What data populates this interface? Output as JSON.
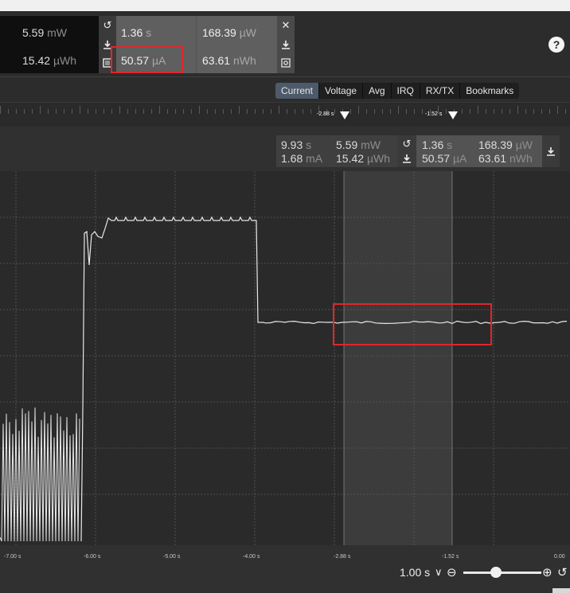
{
  "top_stats": {
    "power": {
      "value": "5.59",
      "unit": "mW"
    },
    "energy": {
      "value": "15.42",
      "unit": "µWh"
    }
  },
  "selection_stats": {
    "time": {
      "value": "1.36",
      "unit": "s"
    },
    "current": {
      "value": "50.57",
      "unit": "µA"
    },
    "power": {
      "value": "168.39",
      "unit": "µW"
    },
    "energy": {
      "value": "63.61",
      "unit": "nWh"
    }
  },
  "icons": {
    "reset": "reset-icon",
    "export": "download-icon",
    "log": "log-icon",
    "close": "close-icon",
    "screenshot": "screenshot-icon",
    "help": "help-icon",
    "help_glyph": "?"
  },
  "tabs": [
    {
      "label": "Current",
      "active": true
    },
    {
      "label": "Voltage",
      "active": false
    },
    {
      "label": "Avg",
      "active": false
    },
    {
      "label": "IRQ",
      "active": false
    },
    {
      "label": "RX/TX",
      "active": false
    },
    {
      "label": "Bookmarks",
      "active": false
    }
  ],
  "markers": [
    {
      "label": "-2.88 s",
      "time": -2.88
    },
    {
      "label": "-1.52 s",
      "time": -1.52
    }
  ],
  "cursor_info": {
    "window": {
      "time": {
        "value": "9.93",
        "unit": "s"
      },
      "current": {
        "value": "1.68",
        "unit": "mA"
      },
      "power": {
        "value": "5.59",
        "unit": "mW"
      },
      "energy": {
        "value": "15.42",
        "unit": "µWh"
      }
    },
    "selection": {
      "time": {
        "value": "1.36",
        "unit": "s"
      },
      "current": {
        "value": "50.57",
        "unit": "µA"
      },
      "power": {
        "value": "168.39",
        "unit": "µW"
      },
      "energy": {
        "value": "63.61",
        "unit": "nWh"
      }
    }
  },
  "x_axis": {
    "ticks": [
      "-7.00 s",
      "-6.00 s",
      "-5.00 s",
      "-4.00 s",
      "-2.88 s",
      "-1.52 s",
      "0.00"
    ]
  },
  "zoom": {
    "label": "1.00 s",
    "minus": "⊖",
    "plus": "⊕",
    "dropdown": "∨",
    "reset": "↺"
  },
  "colors": {
    "highlight": "#e0262b",
    "trace": "#e8e8e8",
    "active_tab": "#4d5a69"
  }
}
